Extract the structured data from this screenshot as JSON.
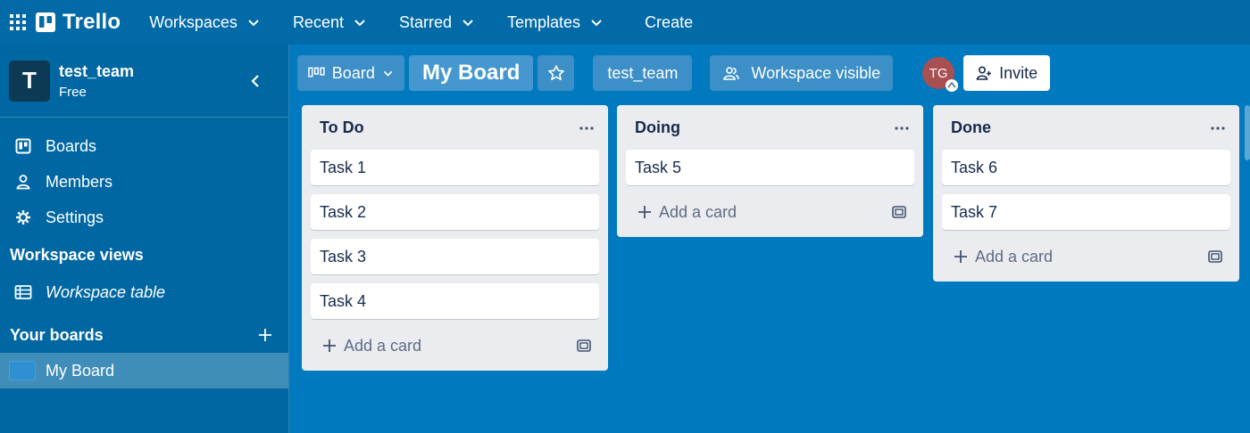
{
  "topnav": {
    "brand": "Trello",
    "items": [
      {
        "label": "Workspaces"
      },
      {
        "label": "Recent"
      },
      {
        "label": "Starred"
      },
      {
        "label": "Templates"
      }
    ],
    "create_label": "Create"
  },
  "sidebar": {
    "workspace_initial": "T",
    "workspace_name": "test_team",
    "workspace_plan": "Free",
    "links": [
      {
        "label": "Boards",
        "icon": "board-icon"
      },
      {
        "label": "Members",
        "icon": "person-icon"
      },
      {
        "label": "Settings",
        "icon": "gear-icon"
      }
    ],
    "views_title": "Workspace views",
    "workspace_table": "Workspace table",
    "your_boards_title": "Your boards",
    "boards": [
      {
        "label": "My Board"
      }
    ]
  },
  "board_header": {
    "view_label": "Board",
    "title": "My Board",
    "team": "test_team",
    "visibility": "Workspace visible",
    "member_initials": "TG",
    "invite_label": "Invite"
  },
  "lists": [
    {
      "title": "To Do",
      "cards": [
        "Task 1",
        "Task 2",
        "Task 3",
        "Task 4"
      ],
      "add_label": "Add a card"
    },
    {
      "title": "Doing",
      "cards": [
        "Task 5"
      ],
      "add_label": "Add a card"
    },
    {
      "title": "Done",
      "cards": [
        "Task 6",
        "Task 7"
      ],
      "add_label": "Add a card"
    }
  ],
  "colors": {
    "board_background": "#0079bf",
    "topnav": "#026aa7",
    "sidebar": "#0067a3",
    "list": "#ebecf0",
    "avatar": "#a84f52"
  }
}
